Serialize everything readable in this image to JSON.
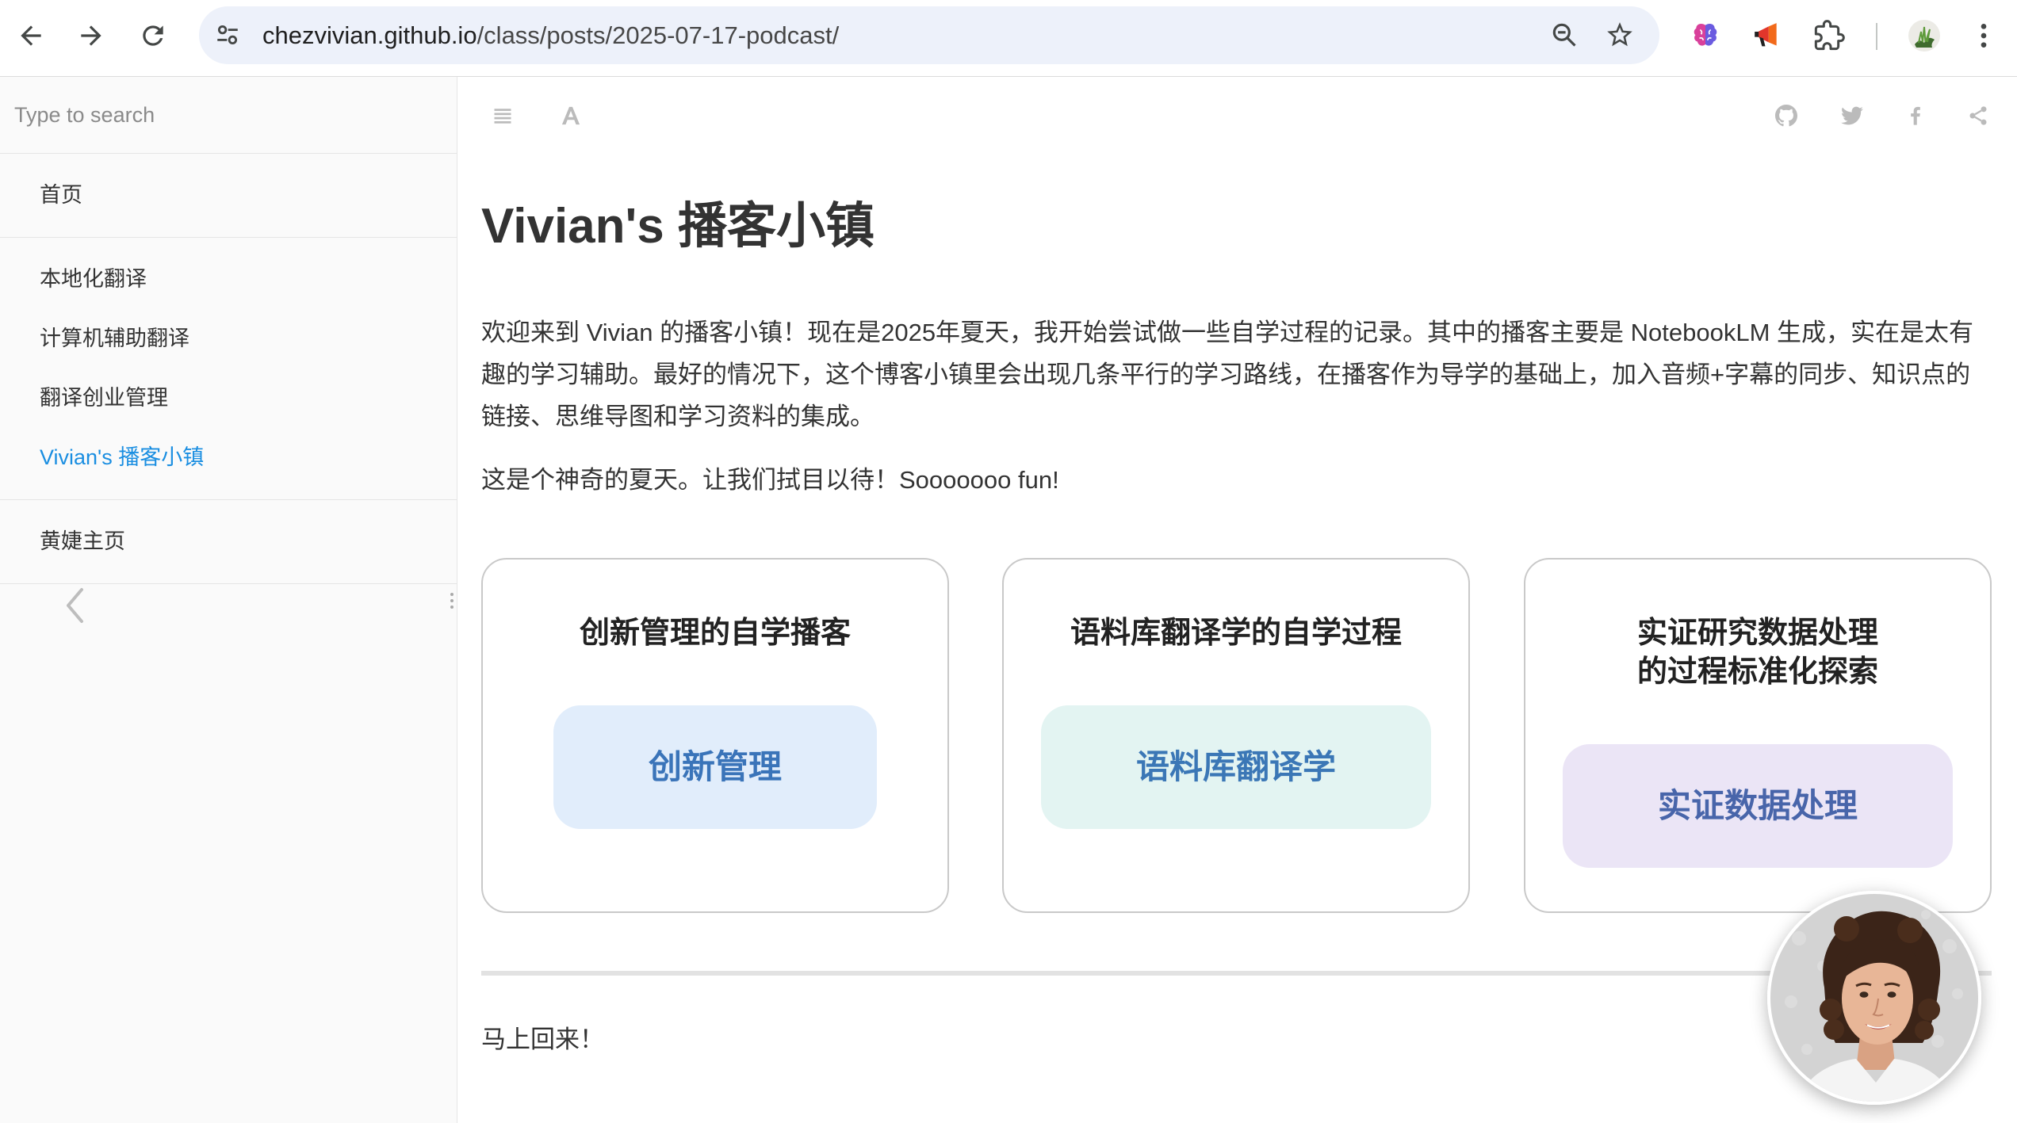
{
  "browser": {
    "url_host": "chezvivian.github.io",
    "url_path": "/class/posts/2025-07-17-podcast/",
    "nav_icons": [
      "back-icon",
      "forward-icon",
      "reload-icon"
    ],
    "address_icons": [
      "site-info-icon",
      "zoom-icon",
      "bookmark-star-icon"
    ],
    "toolbar_icons": [
      "brain-extension-icon",
      "megaphone-extension-icon",
      "extensions-puzzle-icon",
      "profile-avatar",
      "menu-kebab-icon"
    ]
  },
  "sidebar": {
    "search_placeholder": "Type to search",
    "groups": [
      {
        "items": [
          {
            "label": "首页",
            "active": false
          }
        ]
      },
      {
        "items": [
          {
            "label": "本地化翻译",
            "active": false
          },
          {
            "label": "计算机辅助翻译",
            "active": false
          },
          {
            "label": "翻译创业管理",
            "active": false
          },
          {
            "label": "Vivian's 播客小镇",
            "active": true
          }
        ]
      },
      {
        "items": [
          {
            "label": "黄婕主页",
            "active": false
          }
        ]
      }
    ],
    "prev_arrow_icon": "chevron-left-icon"
  },
  "toolbar": {
    "left_icons": [
      "hamburger-icon",
      "font-settings-icon"
    ],
    "right_icons": [
      "github-icon",
      "twitter-icon",
      "facebook-icon",
      "share-icon"
    ]
  },
  "page": {
    "title": "Vivian's 播客小镇",
    "paragraphs": [
      "欢迎来到 Vivian 的播客小镇！现在是2025年夏天，我开始尝试做一些自学过程的记录。其中的播客主要是 NotebookLM 生成，实在是太有趣的学习辅助。最好的情况下，这个博客小镇里会出现几条平行的学习路线，在播客作为导学的基础上，加入音频+字幕的同步、知识点的链接、思维导图和学习资料的集成。",
      "这是个神奇的夏天。让我们拭目以待！Sooooooo fun!"
    ],
    "cards": [
      {
        "title": "创新管理的自学播客",
        "button": "创新管理",
        "button_bg": "#e1edfb",
        "button_color": "#3a74b9"
      },
      {
        "title": "语料库翻译学的自学过程",
        "button": "语料库翻译学",
        "button_bg": "#e3f4f2",
        "button_color": "#3b77b6"
      },
      {
        "title": "实证研究数据处理\n的过程标准化探索",
        "button": "实证数据处理",
        "button_bg": "#ebe5f6",
        "button_color": "#4865aa"
      }
    ],
    "closing": "马上回来！",
    "floating_avatar": "presenter-photo"
  },
  "colors": {
    "accent": "#1a8ee1",
    "text": "#333333",
    "sidebar_bg": "#fafafa",
    "address_bar_bg": "#edf1fa",
    "card_border": "#c9c9c9",
    "toolbar_icon": "#bbbbbb"
  }
}
